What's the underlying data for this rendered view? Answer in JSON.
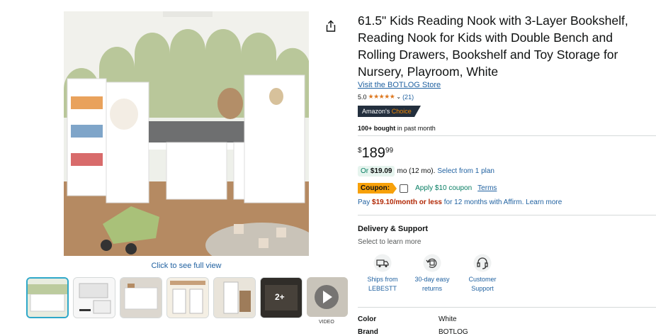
{
  "product": {
    "title": "61.5\" Kids Reading Nook with 3-Layer Bookshelf, Reading Nook for Kids with Double Bench and Rolling Drawers, Bookshelf and Toy Storage for Nursery, Playroom, White",
    "store_link": "Visit the BOTLOG Store",
    "rating_value": "5.0",
    "stars": "★★★★★",
    "rating_count": "(21)",
    "badge_main": "Amazon's",
    "badge_accent": "Choice",
    "bought_bold": "100+ bought",
    "bought_rest": " in past month"
  },
  "price": {
    "symbol": "$",
    "whole": "189",
    "fraction": "99"
  },
  "monthly": {
    "or": "Or ",
    "amount": "$19.09",
    "term": " mo (12 mo).",
    "plan_link": "Select from 1 plan"
  },
  "coupon": {
    "tag": "Coupon:",
    "apply_text": "Apply $10 coupon",
    "terms": "Terms"
  },
  "affirm": {
    "pre": "Pay ",
    "bold": "$19.10/month or less",
    "post": " for 12 months with Affirm. Learn more"
  },
  "delivery": {
    "title": "Delivery & Support",
    "subtitle": "Select to learn more",
    "features": [
      {
        "icon": "truck-icon",
        "line1": "Ships from",
        "line2": "LEBESTT"
      },
      {
        "icon": "return-icon",
        "line1": "30-day easy",
        "line2": "returns"
      },
      {
        "icon": "support-icon",
        "line1": "Customer",
        "line2": "Support"
      }
    ]
  },
  "gallery": {
    "see_full": "Click to see full view",
    "more_count": "2+",
    "video_label": "VIDEO"
  },
  "specs": [
    {
      "key": "Color",
      "value": "White"
    },
    {
      "key": "Brand",
      "value": "BOTLOG"
    }
  ],
  "colors": {
    "link": "#2162a1",
    "star": "#de7921",
    "badge_bg": "#232f3e",
    "badge_accent": "#f08804",
    "coupon_tag": "#f7a10a",
    "green": "#067d62",
    "affirm_bold": "#b12704"
  }
}
